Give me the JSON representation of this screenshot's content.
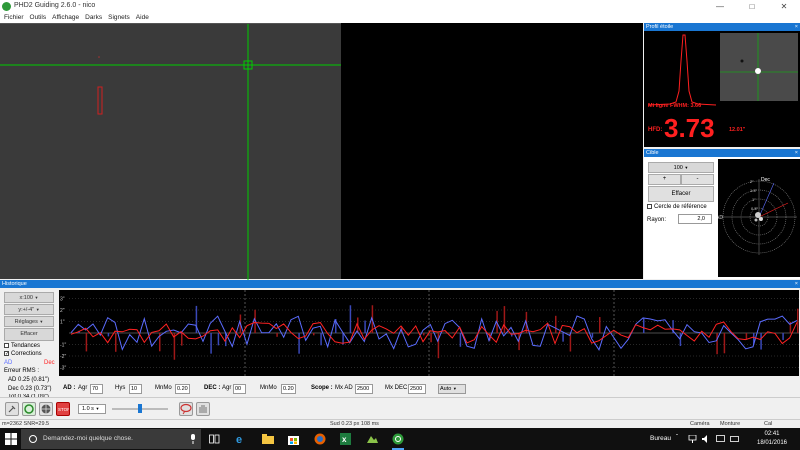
{
  "window": {
    "title": "PHD2 Guiding 2.6.0 - nico"
  },
  "menu": [
    "Fichier",
    "Outils",
    "Affichage",
    "Darks",
    "Signets",
    "Aide"
  ],
  "colors": {
    "accent": "#1976d2",
    "ra": "#5b6cff",
    "dec": "#ff2222",
    "crosshair": "#00cc00",
    "star_fwhm": "#ff2020"
  },
  "profile": {
    "title": "Profil étoile",
    "close": "×",
    "fwhm_label": "Mi ligne FWHM: 3.66",
    "hfd_label": "HFD:",
    "hfd_value": "3.73",
    "hfd_arcsec": "12.01\""
  },
  "target": {
    "title": "Cible",
    "close": "×",
    "scale_select": "100",
    "zoom_in": "+",
    "zoom_out": "-",
    "clear": "Effacer",
    "ref_circle_label": "Cercle de référence",
    "radius_label": "Rayon:",
    "radius_value": "2,0",
    "dec_label": "Dec",
    "ra_label": "AD",
    "ring_labels": [
      "2\"",
      "1.5\"",
      "1\"",
      "0.5\""
    ]
  },
  "history": {
    "title": "Historique",
    "close": "×",
    "x_scale": "x:100",
    "y_scale": "y:+/-4\"",
    "settings": "Réglages",
    "clear": "Effacer",
    "trends": "Tendances",
    "corrections": "Corrections",
    "ra_legend": "AD",
    "dec_legend": "Dec",
    "rms_title": "Erreur RMS :",
    "rms_ra": "AD 0.25 (0.81\")",
    "rms_dec": "Dec 0.23 (0.73\")",
    "rms_tot": "Tot 0.34 (1.09\")",
    "y_labels": [
      "3\"",
      "2\"",
      "1\"",
      "-1\"",
      "-2\"",
      "-3\""
    ]
  },
  "params": {
    "ra_label": "AD :",
    "agr_label": "Agr",
    "ra_agr": "70",
    "hys_label": "Hys",
    "hys": "10",
    "mnmo_label": "MnMo",
    "ra_mnmo": "0.20",
    "dec_label": "DEC :",
    "dec_agr": "00",
    "dec_mnmo": "0.20",
    "scope_label": "Scope :",
    "mx_ad_label": "Mx AD",
    "mx_ad": "2500",
    "mx_dec_label": "Mx DEC",
    "mx_dec": "2500",
    "mode": "Auto"
  },
  "toolbar": {
    "exposure": "1.0 s"
  },
  "status": {
    "star": "m=2362 SNR=29.5",
    "guide": "Sud 0.23 px 108 ms",
    "camera": "Caméra",
    "mount": "Monture",
    "cal": "Cal"
  },
  "taskbar": {
    "search_placeholder": "Demandez-moi quelque chose.",
    "desktop": "Bureau",
    "time": "02:41",
    "date": "18/01/2016"
  }
}
